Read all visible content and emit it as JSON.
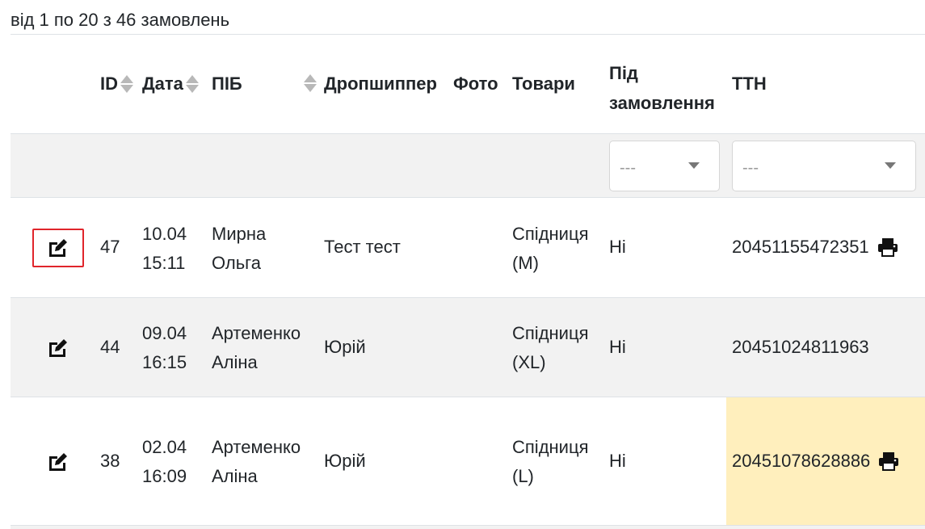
{
  "summary": "від 1 по 20 з 46 замовлень",
  "columns": {
    "id": "ID",
    "date": "Дата",
    "name": "ПІБ",
    "dropshipper": "Дропшиппер",
    "photo": "Фото",
    "goods": "Товари",
    "preorder_line1": "Під",
    "preorder_line2": "замовлення",
    "ttn": "ТТН"
  },
  "filters": {
    "preorder": "---",
    "ttn": "---"
  },
  "rows": [
    {
      "id": "47",
      "date": "10.04",
      "time": "15:11",
      "name_line1": "Мирна",
      "name_line2": "Ольга",
      "dropshipper": "Тест тест",
      "goods_line1": "Спідниця",
      "goods_line2": "(M)",
      "preorder": "Ні",
      "ttn": "20451155472351",
      "printer": true
    },
    {
      "id": "44",
      "date": "09.04",
      "time": "16:15",
      "name_line1": "Артеменко",
      "name_line2": "Аліна",
      "dropshipper": "Юрій",
      "goods_line1": "Спідниця",
      "goods_line2": "(XL)",
      "preorder": "Ні",
      "ttn": "20451024811963",
      "printer": false
    },
    {
      "id": "38",
      "date": "02.04",
      "time": "16:09",
      "name_line1": "Артеменко",
      "name_line2": "Аліна",
      "dropshipper": "Юрій",
      "goods_line1": "Спідниця",
      "goods_line2": "(L)",
      "preorder": "Ні",
      "ttn": "20451078628886",
      "printer": true
    }
  ],
  "colors": {
    "accent_outline": "#e0252b",
    "ttn_highlight": "#ffefbd",
    "row_alt": "#f2f2f2"
  },
  "icons": {
    "edit": "edit-icon",
    "print": "printer-icon",
    "sort": "sort-icon",
    "dropdown": "chevron-down-icon"
  }
}
